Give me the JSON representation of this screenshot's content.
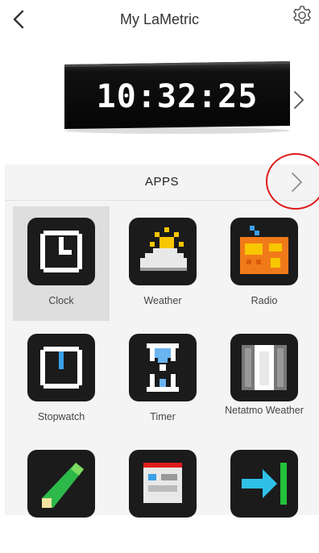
{
  "header": {
    "title": "My LaMetric"
  },
  "device": {
    "time": "10:32:25"
  },
  "apps": {
    "title": "APPS",
    "items": [
      {
        "label": "Clock",
        "icon": "clock-icon",
        "selected": true
      },
      {
        "label": "Weather",
        "icon": "weather-icon"
      },
      {
        "label": "Radio",
        "icon": "radio-icon"
      },
      {
        "label": "Stopwatch",
        "icon": "stopwatch-icon"
      },
      {
        "label": "Timer",
        "icon": "timer-icon"
      },
      {
        "label": "Netatmo Weather",
        "icon": "netatmo-weather-icon"
      },
      {
        "label": "",
        "icon": "progress-bar-icon"
      },
      {
        "label": "",
        "icon": "calendar-icon"
      },
      {
        "label": "",
        "icon": "arrow-right-icon"
      }
    ]
  },
  "colors": {
    "annotation_circle": "#e21b1b",
    "tile_selected": "#dedede",
    "panel": "#f4f4f4"
  }
}
